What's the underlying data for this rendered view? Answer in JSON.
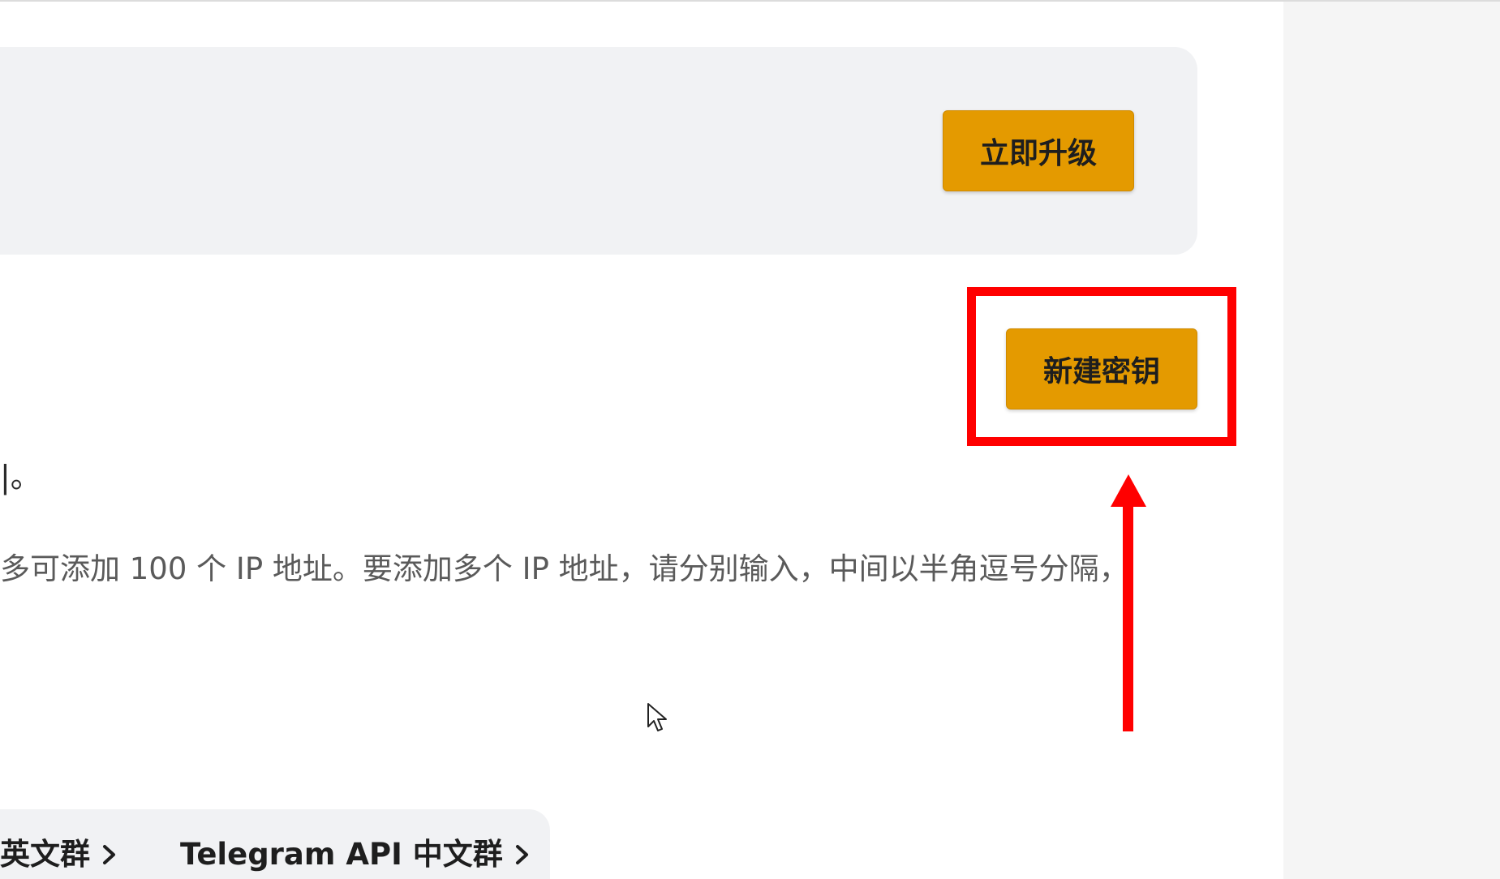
{
  "upgrade_card": {
    "button_label": "立即升级"
  },
  "api_keys": {
    "new_key_button_label": "新建密钥",
    "text_fragment": "|。",
    "ip_description": "多可添加 100 个 IP 地址。要添加多个 IP 地址，请分别输入，中间以半角逗号分隔，"
  },
  "footer": {
    "links": [
      {
        "label": "英文群",
        "icon": "chevron-right-icon"
      },
      {
        "label": "Telegram API 中文群",
        "icon": "chevron-right-icon"
      }
    ]
  },
  "annotation": {
    "color": "#ff0000"
  },
  "colors": {
    "button_bg": "#e49a00",
    "card_bg": "#f1f2f4",
    "right_panel_bg": "#f5f5f5"
  }
}
